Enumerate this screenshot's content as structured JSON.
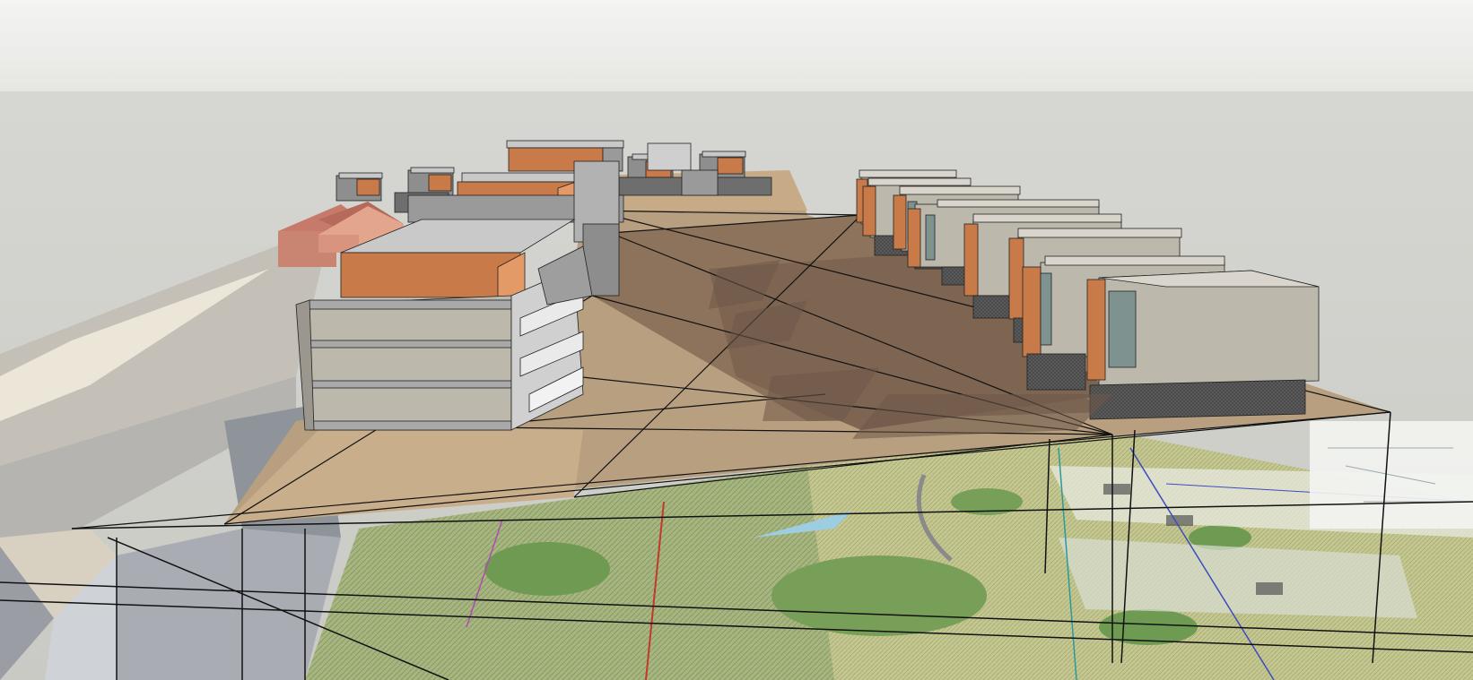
{
  "scene": {
    "kind": "3d-model-viewport",
    "sky_top_color": "#f4f4f2",
    "sky_bottom_color": "#e6e6e3",
    "backdrop_color": "#d0d0cc",
    "terrain_color": "#b59b78",
    "terrain_shadow_color": "#8a7058",
    "facade_color": "#bdb8ac",
    "accent_color": "#c87a48",
    "roof_color": "#c9c9c9",
    "house_color": "#cf8a78",
    "site_plan_green": "#9fb37a",
    "road_color": "#c9c6bf",
    "edge_color": "#111111"
  }
}
